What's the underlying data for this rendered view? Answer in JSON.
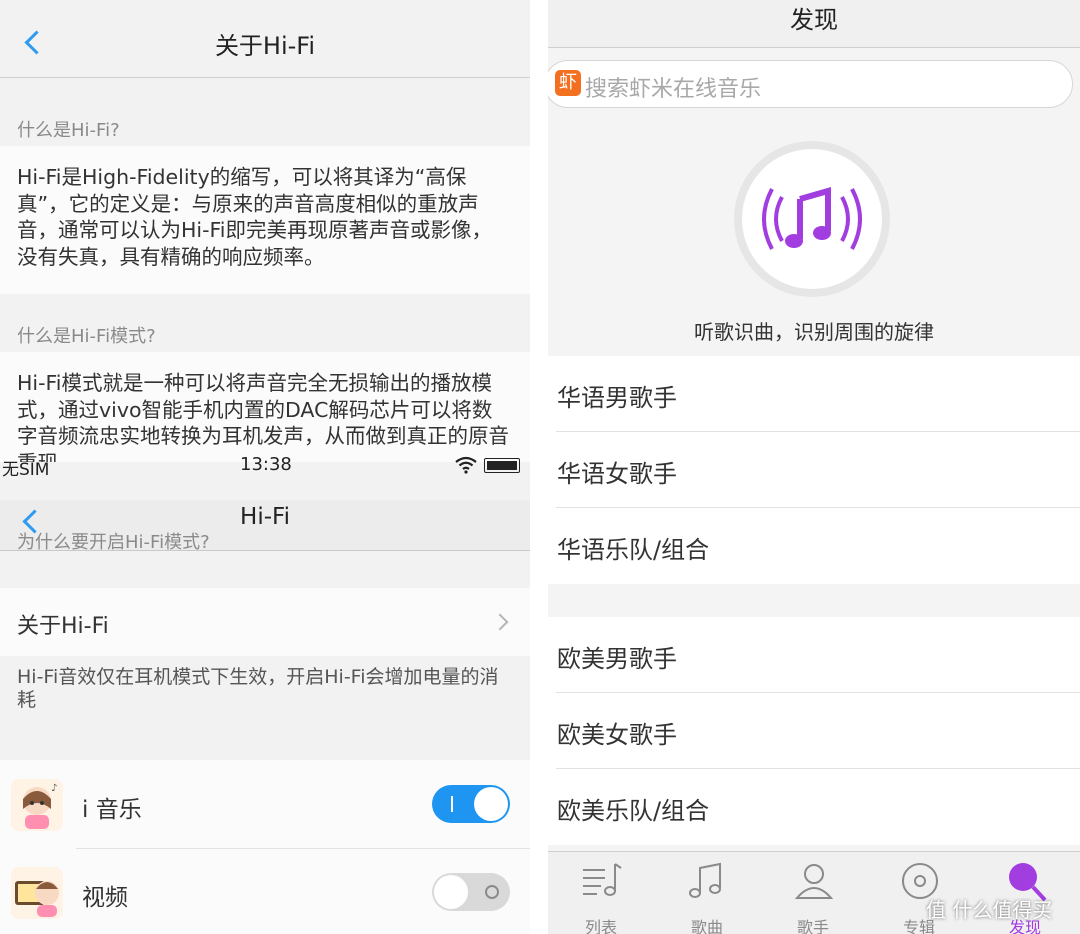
{
  "left": {
    "title": "关于Hi-Fi",
    "q1": "什么是Hi-Fi?",
    "a1": "Hi-Fi是High-Fidelity的缩写，可以将其译为“高保真”，它的定义是：与原来的声音高度相似的重放声音，通常可以认为Hi-Fi即完美再现原著声音或影像，没有失真，具有精确的响应频率。",
    "q2": "什么是Hi-Fi模式?",
    "a2": "Hi-Fi模式就是一种可以将声音完全无损输出的播放模式，通过vivo智能手机内置的DAC解码芯片可以将数字音频流忠实地转换为耳机发声，从而做到真正的原音重现。",
    "q3": "为什么要开启Hi-Fi模式?",
    "status": {
      "carrier": "无SIM",
      "time": "13:38"
    },
    "hifi_title": "Hi-Fi",
    "about_row": "关于Hi-Fi",
    "note": "Hi-Fi音效仅在耳机模式下生效，开启Hi-Fi会增加电量的消耗",
    "apps": [
      {
        "name": "i 音乐",
        "on": true,
        "toggle_color": "#1e95f0"
      },
      {
        "name": "视频",
        "on": false,
        "toggle_color": "#d9d9d9"
      }
    ]
  },
  "right": {
    "title": "发现",
    "search_badge": "虾",
    "search_placeholder": "搜索虾米在线音乐",
    "recognize_caption": "听歌识曲，识别周围的旋律",
    "group1": [
      "华语男歌手",
      "华语女歌手",
      "华语乐队/组合"
    ],
    "group2": [
      "欧美男歌手",
      "欧美女歌手",
      "欧美乐队/组合"
    ],
    "tabs": [
      {
        "label": "列表",
        "icon": "list-music-icon"
      },
      {
        "label": "歌曲",
        "icon": "music-note-icon"
      },
      {
        "label": "歌手",
        "icon": "person-icon"
      },
      {
        "label": "专辑",
        "icon": "disc-icon"
      },
      {
        "label": "发现",
        "icon": "search-icon",
        "active": true
      }
    ],
    "accent": "#a23de0"
  },
  "watermark": "值 什么值得买"
}
